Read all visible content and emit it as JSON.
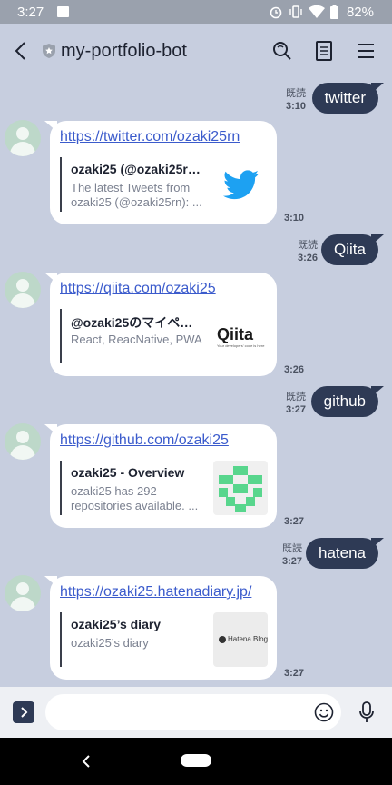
{
  "status": {
    "time": "3:27",
    "battery": "82%",
    "icons": [
      "alarm-icon",
      "vibrate-icon",
      "wifi-icon",
      "battery-icon"
    ]
  },
  "header": {
    "title": "my-portfolio-bot",
    "actions": [
      "search-icon",
      "notes-icon",
      "menu-icon"
    ]
  },
  "messages": [
    {
      "sent_text": "twitter",
      "read_label": "既読",
      "sent_time": "3:10",
      "link": "https://twitter.com/ozaki25rn",
      "preview_title": "ozaki25 (@ozaki25rn) / Twitter",
      "preview_desc": "The latest Tweets from ozaki25 (@ozaki25rn): ...",
      "reply_time": "3:10"
    },
    {
      "sent_text": "Qiita",
      "read_label": "既読",
      "sent_time": "3:26",
      "link": "https://qiita.com/ozaki25",
      "preview_title": "@ozaki25のマイページ - Qiita",
      "preview_desc": "React, ReacNative, PWA",
      "thumb_text": "Qiita",
      "thumb_sub": "Your developers' code is here",
      "reply_time": "3:26"
    },
    {
      "sent_text": "github",
      "read_label": "既読",
      "sent_time": "3:27",
      "link": "https://github.com/ozaki25",
      "preview_title": "ozaki25 - Overview",
      "preview_desc": "ozaki25 has 292 repositories available. ...",
      "reply_time": "3:27"
    },
    {
      "sent_text": "hatena",
      "read_label": "既読",
      "sent_time": "3:27",
      "link": "https://ozaki25.hatenadiary.jp/",
      "preview_title": "ozaki25’s diary",
      "preview_desc": "ozaki25’s diary",
      "thumb_text": "Hatena Blog",
      "reply_time": "3:27"
    }
  ],
  "colors": {
    "background": "#c7cedf",
    "sent_bubble": "#2e3a55",
    "link": "#3b5bcc",
    "twitter": "#1da1f2",
    "qiita": "#55c500",
    "github_identicon": "#58d68d"
  }
}
